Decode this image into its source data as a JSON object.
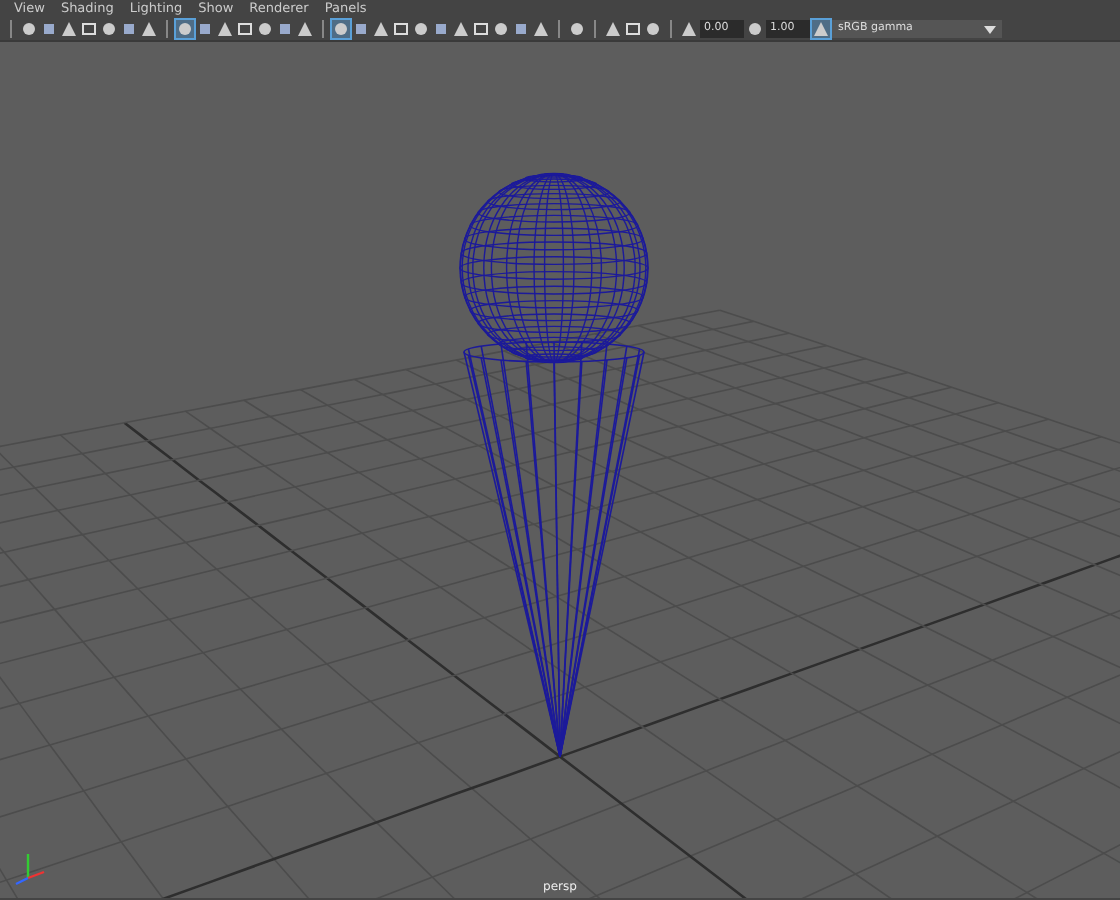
{
  "menu": [
    "View",
    "Shading",
    "Lighting",
    "Show",
    "Renderer",
    "Panels"
  ],
  "toolbar": [
    {
      "kind": "sep"
    },
    {
      "kind": "icon",
      "selected": false
    },
    {
      "kind": "icon",
      "selected": false
    },
    {
      "kind": "icon",
      "selected": false
    },
    {
      "kind": "icon",
      "selected": false
    },
    {
      "kind": "icon",
      "selected": false
    },
    {
      "kind": "icon",
      "selected": false
    },
    {
      "kind": "icon",
      "selected": false
    },
    {
      "kind": "sep"
    },
    {
      "kind": "icon",
      "selected": true
    },
    {
      "kind": "icon",
      "selected": false
    },
    {
      "kind": "icon",
      "selected": false
    },
    {
      "kind": "icon",
      "selected": false
    },
    {
      "kind": "icon",
      "selected": false
    },
    {
      "kind": "icon",
      "selected": false
    },
    {
      "kind": "icon",
      "selected": false
    },
    {
      "kind": "sep"
    },
    {
      "kind": "icon",
      "selected": true
    },
    {
      "kind": "icon",
      "selected": false
    },
    {
      "kind": "icon",
      "selected": false
    },
    {
      "kind": "icon",
      "selected": false
    },
    {
      "kind": "icon",
      "selected": false
    },
    {
      "kind": "icon",
      "selected": false
    },
    {
      "kind": "icon",
      "selected": false
    },
    {
      "kind": "icon",
      "selected": false
    },
    {
      "kind": "icon",
      "selected": false
    },
    {
      "kind": "icon",
      "selected": false
    },
    {
      "kind": "icon",
      "selected": false
    },
    {
      "kind": "sep"
    },
    {
      "kind": "icon",
      "selected": false
    },
    {
      "kind": "sep"
    },
    {
      "kind": "icon",
      "selected": false
    },
    {
      "kind": "icon",
      "selected": false
    },
    {
      "kind": "icon",
      "selected": false
    },
    {
      "kind": "sep"
    },
    {
      "kind": "icon",
      "selected": false
    },
    {
      "kind": "field",
      "value": "0.00"
    },
    {
      "kind": "icon",
      "selected": false
    },
    {
      "kind": "field",
      "value": "1.00"
    },
    {
      "kind": "icon",
      "selected": true
    },
    {
      "kind": "dropdown",
      "value": "sRGB gamma"
    }
  ],
  "viewport": {
    "camera_label": "persp"
  }
}
